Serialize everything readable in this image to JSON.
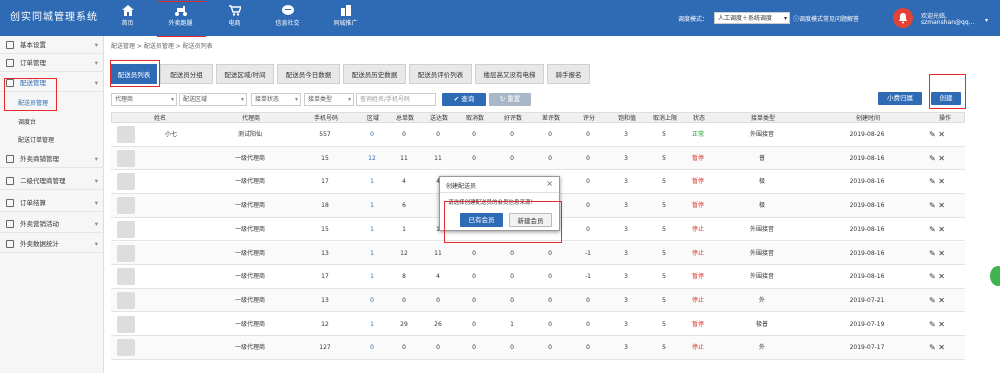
{
  "brand": "创实同城管理系统",
  "nav": [
    {
      "label": "首页",
      "icon": "home-icon"
    },
    {
      "label": "外卖跑腿",
      "icon": "scooter-icon"
    },
    {
      "label": "电商",
      "icon": "cart-icon"
    },
    {
      "label": "信息社交",
      "icon": "chat-icon"
    },
    {
      "label": "同城推广",
      "icon": "building-icon"
    }
  ],
  "dispatch": {
    "label": "调度模式：",
    "value": "人工调度＋系统调度",
    "help": "调度模式常见问题解答"
  },
  "user": {
    "welcome": "欢迎光临,",
    "name": "szmanshan@qq..."
  },
  "sidebar": {
    "items": [
      "基本设置",
      "订单管理",
      "配送管理",
      "外卖商铺管理",
      "二级代理商管理",
      "订单结算",
      "外卖营销活动",
      "外卖数据统计"
    ],
    "sub": [
      "配送员管理",
      "调度台",
      "配送订单管理"
    ]
  },
  "breadcrumb": "配送管理 > 配送员管理 > 配送员列表",
  "tabs": [
    "配送员列表",
    "配送员分组",
    "配送区域/时间",
    "配送员今日数据",
    "配送员历史数据",
    "配送员评价列表",
    "楼层高又没有电梯",
    "骑手报名"
  ],
  "toolbar": {
    "small_fee": "小费归属",
    "create": "创建"
  },
  "filters": {
    "agent": "代理商",
    "area": "配送区域",
    "status": "接单状态",
    "type": "接单类型",
    "search_placeholder": "查询姓名/手机号码",
    "query": "查询",
    "reset": "重置"
  },
  "table": {
    "headers": [
      "姓名",
      "代理商",
      "手机号码",
      "区域",
      "总单数",
      "送达数",
      "取消数",
      "好评数",
      "差评数",
      "评分",
      "饱和值",
      "取消上限",
      "状态",
      "接单类型",
      "创建时间",
      "操作"
    ],
    "rows": [
      {
        "name": "小七",
        "agent": "测试阳仙",
        "phone": "557",
        "area": "0",
        "total": "0",
        "delivered": "0",
        "cancel": "0",
        "good": "0",
        "bad": "0",
        "score": "0",
        "sat": "3",
        "limit": "5",
        "status": "正常",
        "type": "外围接音",
        "date": "2019-08-26"
      },
      {
        "name": "",
        "agent": "一级代理商",
        "phone": "15",
        "area": "12",
        "total": "11",
        "delivered": "11",
        "cancel": "0",
        "good": "0",
        "bad": "0",
        "score": "0",
        "sat": "3",
        "limit": "5",
        "status": "暂停",
        "type": "普",
        "date": "2019-08-16"
      },
      {
        "name": "",
        "agent": "一级代理商",
        "phone": "17",
        "area": "1",
        "total": "4",
        "delivered": "4",
        "cancel": "0",
        "good": "0",
        "bad": "0",
        "score": "0",
        "sat": "3",
        "limit": "5",
        "status": "暂停",
        "type": "极",
        "date": "2019-08-16"
      },
      {
        "name": "",
        "agent": "一级代理商",
        "phone": "18",
        "area": "1",
        "total": "6",
        "delivered": "",
        "cancel": "0",
        "good": "0",
        "bad": "0",
        "score": "0",
        "sat": "3",
        "limit": "5",
        "status": "暂停",
        "type": "极",
        "date": "2019-08-16"
      },
      {
        "name": "",
        "agent": "一级代理商",
        "phone": "15",
        "area": "1",
        "total": "1",
        "delivered": "1",
        "cancel": "0",
        "good": "0",
        "bad": "0",
        "score": "0",
        "sat": "3",
        "limit": "5",
        "status": "停止",
        "type": "外围接音",
        "date": "2019-08-16"
      },
      {
        "name": "",
        "agent": "一级代理商",
        "phone": "13",
        "area": "1",
        "total": "12",
        "delivered": "11",
        "cancel": "0",
        "good": "0",
        "bad": "0",
        "score": "-1",
        "sat": "3",
        "limit": "5",
        "status": "停止",
        "type": "外围接音",
        "date": "2019-08-16"
      },
      {
        "name": "",
        "agent": "一级代理商",
        "phone": "17",
        "area": "1",
        "total": "8",
        "delivered": "4",
        "cancel": "0",
        "good": "0",
        "bad": "0",
        "score": "-1",
        "sat": "3",
        "limit": "5",
        "status": "暂停",
        "type": "外围接音",
        "date": "2019-08-16"
      },
      {
        "name": "",
        "agent": "一级代理商",
        "phone": "13",
        "area": "0",
        "total": "0",
        "delivered": "0",
        "cancel": "0",
        "good": "0",
        "bad": "0",
        "score": "0",
        "sat": "3",
        "limit": "5",
        "status": "停止",
        "type": "外",
        "date": "2019-07-21"
      },
      {
        "name": "",
        "agent": "一级代理商",
        "phone": "12",
        "area": "1",
        "total": "29",
        "delivered": "26",
        "cancel": "0",
        "good": "1",
        "bad": "0",
        "score": "0",
        "sat": "3",
        "limit": "5",
        "status": "暂停",
        "type": "极普",
        "date": "2019-07-19"
      },
      {
        "name": "",
        "agent": "一级代理商",
        "phone": "127",
        "area": "0",
        "total": "0",
        "delivered": "0",
        "cancel": "0",
        "good": "0",
        "bad": "0",
        "score": "0",
        "sat": "3",
        "limit": "5",
        "status": "停止",
        "type": "外",
        "date": "2019-07-17"
      }
    ]
  },
  "modal": {
    "title": "创建配送员",
    "message": "请选择创建配送员的会员信息来源！",
    "existing": "已有会员",
    "new": "新建会员"
  },
  "colors": {
    "primary": "#2f6ab5",
    "highlight": "#e8282b",
    "normal": "#1a9a2a",
    "stop": "#d9342b"
  }
}
